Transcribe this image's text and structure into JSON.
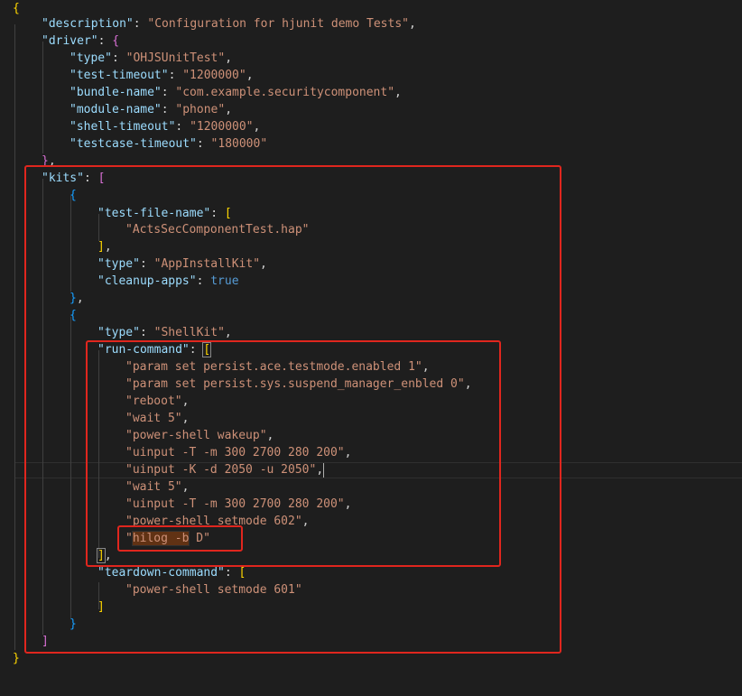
{
  "description_key": "\"description\"",
  "description_value": "\"Configuration for hjunit demo Tests\"",
  "driver_key": "\"driver\"",
  "driver": [
    {
      "key": "\"type\"",
      "value": "\"OHJSUnitTest\""
    },
    {
      "key": "\"test-timeout\"",
      "value": "\"1200000\""
    },
    {
      "key": "\"bundle-name\"",
      "value": "\"com.example.securitycomponent\""
    },
    {
      "key": "\"module-name\"",
      "value": "\"phone\""
    },
    {
      "key": "\"shell-timeout\"",
      "value": "\"1200000\""
    },
    {
      "key": "\"testcase-timeout\"",
      "value": "\"180000\""
    }
  ],
  "kits_key": "\"kits\"",
  "kit1": {
    "test_file_name_key": "\"test-file-name\"",
    "test_file_name_value": "\"ActsSecComponentTest.hap\"",
    "type_key": "\"type\"",
    "type_value": "\"AppInstallKit\"",
    "cleanup_key": "\"cleanup-apps\"",
    "cleanup_value": "true"
  },
  "kit2": {
    "type_key": "\"type\"",
    "type_value": "\"ShellKit\"",
    "run_command_key": "\"run-command\"",
    "run_commands": [
      "\"param set persist.ace.testmode.enabled 1\"",
      "\"param set persist.sys.suspend_manager_enbled 0\"",
      "\"reboot\"",
      "\"wait 5\"",
      "\"power-shell wakeup\"",
      "\"uinput -T -m 300 2700 280 200\"",
      "\"uinput -K -d 2050 -u 2050\"",
      "\"wait 5\"",
      "\"uinput -T -m 300 2700 280 200\"",
      "\"power-shell setmode 602\""
    ],
    "last_cmd": {
      "quote_open": "\"",
      "highlighted": "hilog -b",
      "rest": " D\""
    },
    "teardown_key": "\"teardown-command\"",
    "teardown_value": "\"power-shell setmode 601\""
  }
}
